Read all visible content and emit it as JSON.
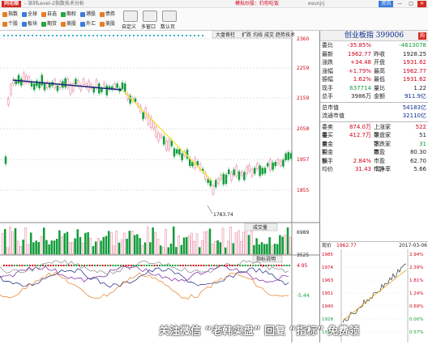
{
  "app": {
    "logo_text": "同花顺",
    "title": "- 深圳Level-2指数技术分析",
    "promo": "模拟炒股：约你吃饭",
    "user": "esunjrj"
  },
  "window": {
    "buttons": [
      "资讯",
      "—",
      "□",
      "✕"
    ]
  },
  "toolbar": {
    "row1": [
      "指数",
      "全球",
      "自选",
      "期权",
      "港股",
      "债券"
    ],
    "row2": [
      "个股",
      "板块",
      "期货",
      "美股",
      "外汇",
      "美股"
    ],
    "tools": [
      "自定义",
      "多窗口",
      "数认页"
    ]
  },
  "chart": {
    "subtabs": [
      "大盘脊柱",
      "扩跌",
      "均线",
      "成交",
      "趋势",
      "技术"
    ],
    "y_labels": [
      "2360",
      "2259",
      "2159",
      "2058",
      "1957",
      "1855"
    ],
    "low_label": "1783.74",
    "vol_tab": "成交量",
    "vol_labels": [
      "6989",
      "3525"
    ],
    "ind_tab": "指标说明",
    "ind_labels": [
      "4.95",
      "-5.44"
    ]
  },
  "quote": {
    "title": "创业板指 399006",
    "tag": "购",
    "rows": [
      {
        "l1": "委比",
        "v1": "-35.85%",
        "l2": "",
        "v2": "-4613078",
        "c1": "red",
        "c2": "green"
      },
      {
        "l1": "最新",
        "v1": "1962.77",
        "l2": "昨收",
        "v2": "1928.25",
        "c1": "red",
        "c2": "blk"
      },
      {
        "l1": "涨跌",
        "v1": "+34.48",
        "l2": "开盘",
        "v2": "1931.62",
        "c1": "red",
        "c2": "red"
      },
      {
        "l1": "涨幅",
        "v1": "+1.79%",
        "l2": "最高",
        "v2": "1962.77",
        "c1": "red",
        "c2": "red"
      },
      {
        "l1": "振幅",
        "v1": "1.62%",
        "l2": "最低",
        "v2": "1931.62",
        "c1": "red",
        "c2": "red"
      },
      {
        "l1": "现手",
        "v1": "637714",
        "l2": "量比",
        "v2": "1.22",
        "c1": "green",
        "c2": "blk"
      },
      {
        "l1": "总手",
        "v1": "3986万",
        "l2": "金额",
        "v2": "911.9亿",
        "c1": "blk",
        "c2": "blue"
      }
    ],
    "cap": [
      {
        "l": "总市值",
        "v": "54183亿"
      },
      {
        "l": "流通市值",
        "v": "32110亿"
      }
    ],
    "rows2": [
      {
        "l1": "委卖量",
        "v1": "874.0万",
        "l2": "上涨家数",
        "v2": "522",
        "c1": "red",
        "c2": "red"
      },
      {
        "l1": "委买量",
        "v1": "412.7万",
        "l2": "平盘家数",
        "v2": "51",
        "c1": "red",
        "c2": "blk"
      },
      {
        "l1": "卖金额",
        "v1": "",
        "l2": "下跌家数",
        "v2": "31",
        "c1": "blk",
        "c2": "green"
      },
      {
        "l1": "买金额",
        "v1": "",
        "l2": "市盈",
        "v2": "80.30",
        "c1": "blk",
        "c2": "blk"
      },
      {
        "l1": "换手",
        "v1": "2.84%",
        "l2": "市盈(动)",
        "v2": "62.70",
        "c1": "red",
        "c2": "blk"
      },
      {
        "l1": "均价",
        "v1": "31.43",
        "l2": "市净率",
        "v2": "5.66",
        "c1": "red",
        "c2": "blk"
      }
    ],
    "mini": {
      "label1": "现价",
      "value1": "1962.77",
      "date": "2017-03-06",
      "left_ticks": [
        "1985",
        "1974",
        "1963",
        "1951",
        "1940",
        "1928",
        "1917"
      ],
      "right_ticks": [
        "2.94%",
        "2.39%",
        "1.81%",
        "1.24%",
        "0.69%",
        "0.00%",
        "0.57%"
      ]
    }
  },
  "watermark": "关注微信 “老韩实盘” 回复 “指标” 免费领"
}
